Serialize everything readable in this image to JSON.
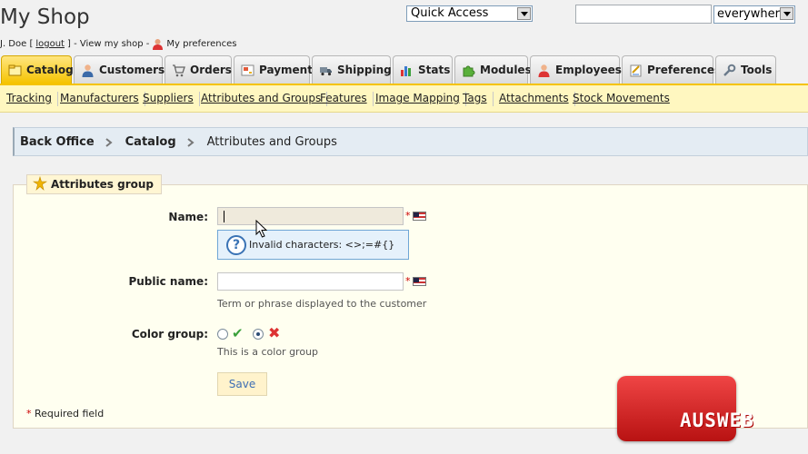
{
  "header": {
    "shop_title": "My Shop",
    "user_name": "J. Doe [",
    "logout_label": "logout",
    "user_mid": "] - View my shop -",
    "preferences_label": "My preferences",
    "quick_access_label": "Quick Access",
    "search_value": "",
    "search_scope": "everywhere"
  },
  "tabs": [
    {
      "label": "Catalog",
      "icon": "catalog-icon",
      "active": true
    },
    {
      "label": "Customers",
      "icon": "customers-icon"
    },
    {
      "label": "Orders",
      "icon": "cart-icon"
    },
    {
      "label": "Payment",
      "icon": "payment-icon"
    },
    {
      "label": "Shipping",
      "icon": "truck-icon"
    },
    {
      "label": "Stats",
      "icon": "bar-chart-icon"
    },
    {
      "label": "Modules",
      "icon": "puzzle-icon"
    },
    {
      "label": "Employees",
      "icon": "employee-icon"
    },
    {
      "label": "Preferences",
      "icon": "preferences-icon"
    },
    {
      "label": "Tools",
      "icon": "wrench-icon"
    }
  ],
  "subnav": [
    "Tracking",
    "Manufacturers",
    "Suppliers",
    "Attributes and Groups",
    "Features",
    "Image Mapping",
    "Tags",
    "Attachments",
    "Stock Movements"
  ],
  "breadcrumb": [
    "Back Office",
    "Catalog",
    "Attributes and Groups"
  ],
  "form": {
    "legend": "Attributes group",
    "name_label": "Name:",
    "name_value": "",
    "required_star": "*",
    "invalid_hint": "Invalid characters: <>;=#{}",
    "public_name_label": "Public name:",
    "public_name_value": "",
    "public_name_help": "Term or phrase displayed to the customer",
    "color_group_label": "Color group:",
    "color_group_selected": "no",
    "color_group_help": "This is a color group",
    "save_label": "Save",
    "required_note": "Required field"
  },
  "watermark": "AUSWEB",
  "colors": {
    "active_tab": "#f5c300",
    "subnav_bg": "#fff7c0",
    "breadcrumb_bg": "#e4ecf3",
    "hint_bg": "#e5f1fb",
    "watermark": "#d62828"
  }
}
